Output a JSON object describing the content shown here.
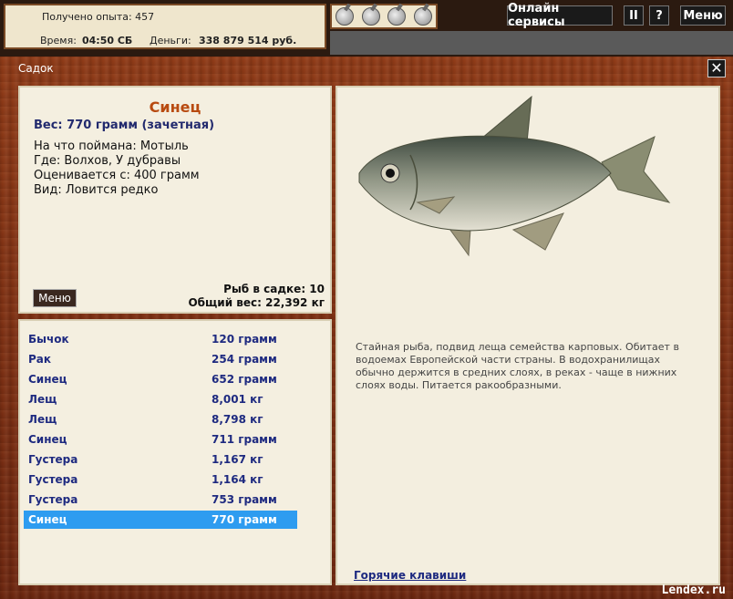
{
  "topbar": {
    "xp_text": "Получено опыта: 457",
    "time_label": "Время:",
    "time_value": "04:50 СБ",
    "money_label": "Деньги:",
    "money_value": "338 879 514 руб.",
    "online_label": "Онлайн сервисы",
    "pause_label": "II",
    "help_label": "?",
    "menu_label": "Меню"
  },
  "window": {
    "title": "Садок",
    "close_label": "✕"
  },
  "fish": {
    "name": "Синец",
    "weight": "Вес: 770 грамм (зачетная)",
    "caught": "На что поймана: Мотыль",
    "where": "Где: Волхов, У дубравы",
    "valued": "Оценивается с: 400 грамм",
    "kind": "Вид: Ловится редко",
    "description": "Стайная рыба, подвид леща семейства карповых. Обитает в водоемах Европейской части страны. В водохранилищах обычно держится в средних слоях, в реках - чаще в нижних слоях воды. Питается ракообразными."
  },
  "keepnet": {
    "menu_label": "Меню",
    "count": "Рыб в садке: 10",
    "total": "Общий вес: 22,392 кг"
  },
  "list": [
    {
      "name": "Бычок",
      "weight": "120 грамм"
    },
    {
      "name": "Рак",
      "weight": "254 грамм"
    },
    {
      "name": "Синец",
      "weight": "652 грамм"
    },
    {
      "name": "Лещ",
      "weight": "8,001 кг"
    },
    {
      "name": "Лещ",
      "weight": "8,798 кг"
    },
    {
      "name": "Синец",
      "weight": "711 грамм"
    },
    {
      "name": "Густера",
      "weight": "1,167 кг"
    },
    {
      "name": "Густера",
      "weight": "1,164 кг"
    },
    {
      "name": "Густера",
      "weight": "753 грамм"
    },
    {
      "name": "Синец",
      "weight": "770 грамм"
    }
  ],
  "selected_index": 9,
  "hotkeys_label": "Горячие клавиши",
  "watermark": "Lendex.ru",
  "colors": {
    "wood": "#7a2f14",
    "panel": "#f4efe0",
    "fish_name": "#b84a10",
    "list_text": "#1e2a80",
    "selection": "#2e9cf0"
  },
  "icons": [
    "potion-icon",
    "potion-icon",
    "potion-icon",
    "potion-icon"
  ]
}
